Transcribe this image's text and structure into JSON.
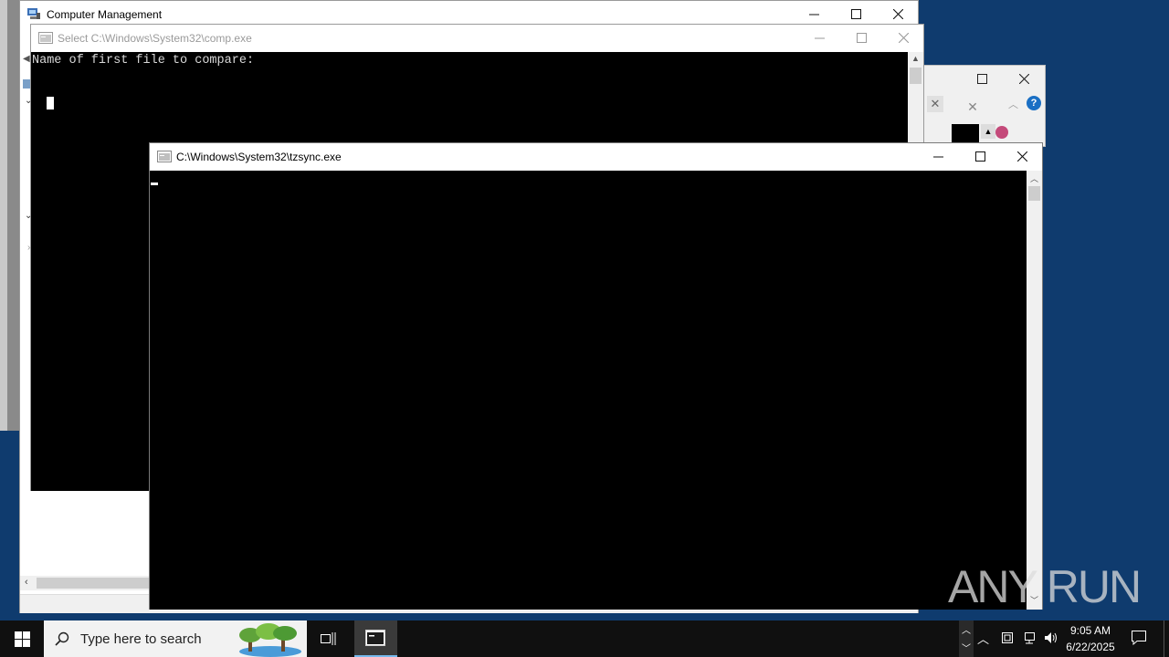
{
  "computer_management": {
    "title": "Computer Management",
    "icon": "computer-management-icon"
  },
  "comp_window": {
    "title": "Select C:\\Windows\\System32\\comp.exe",
    "console_line": "Name of first file to compare:"
  },
  "tzsync_window": {
    "title": "C:\\Windows\\System32\\tzsync.exe"
  },
  "taskbar": {
    "search_placeholder": "Type here to search",
    "time": "9:05 AM",
    "date": "6/22/2025"
  },
  "watermark": {
    "text": "ANY RUN"
  },
  "colors": {
    "desktop": "#0f3b6e",
    "taskbar": "#101010",
    "help_blue": "#1a6fc4"
  }
}
